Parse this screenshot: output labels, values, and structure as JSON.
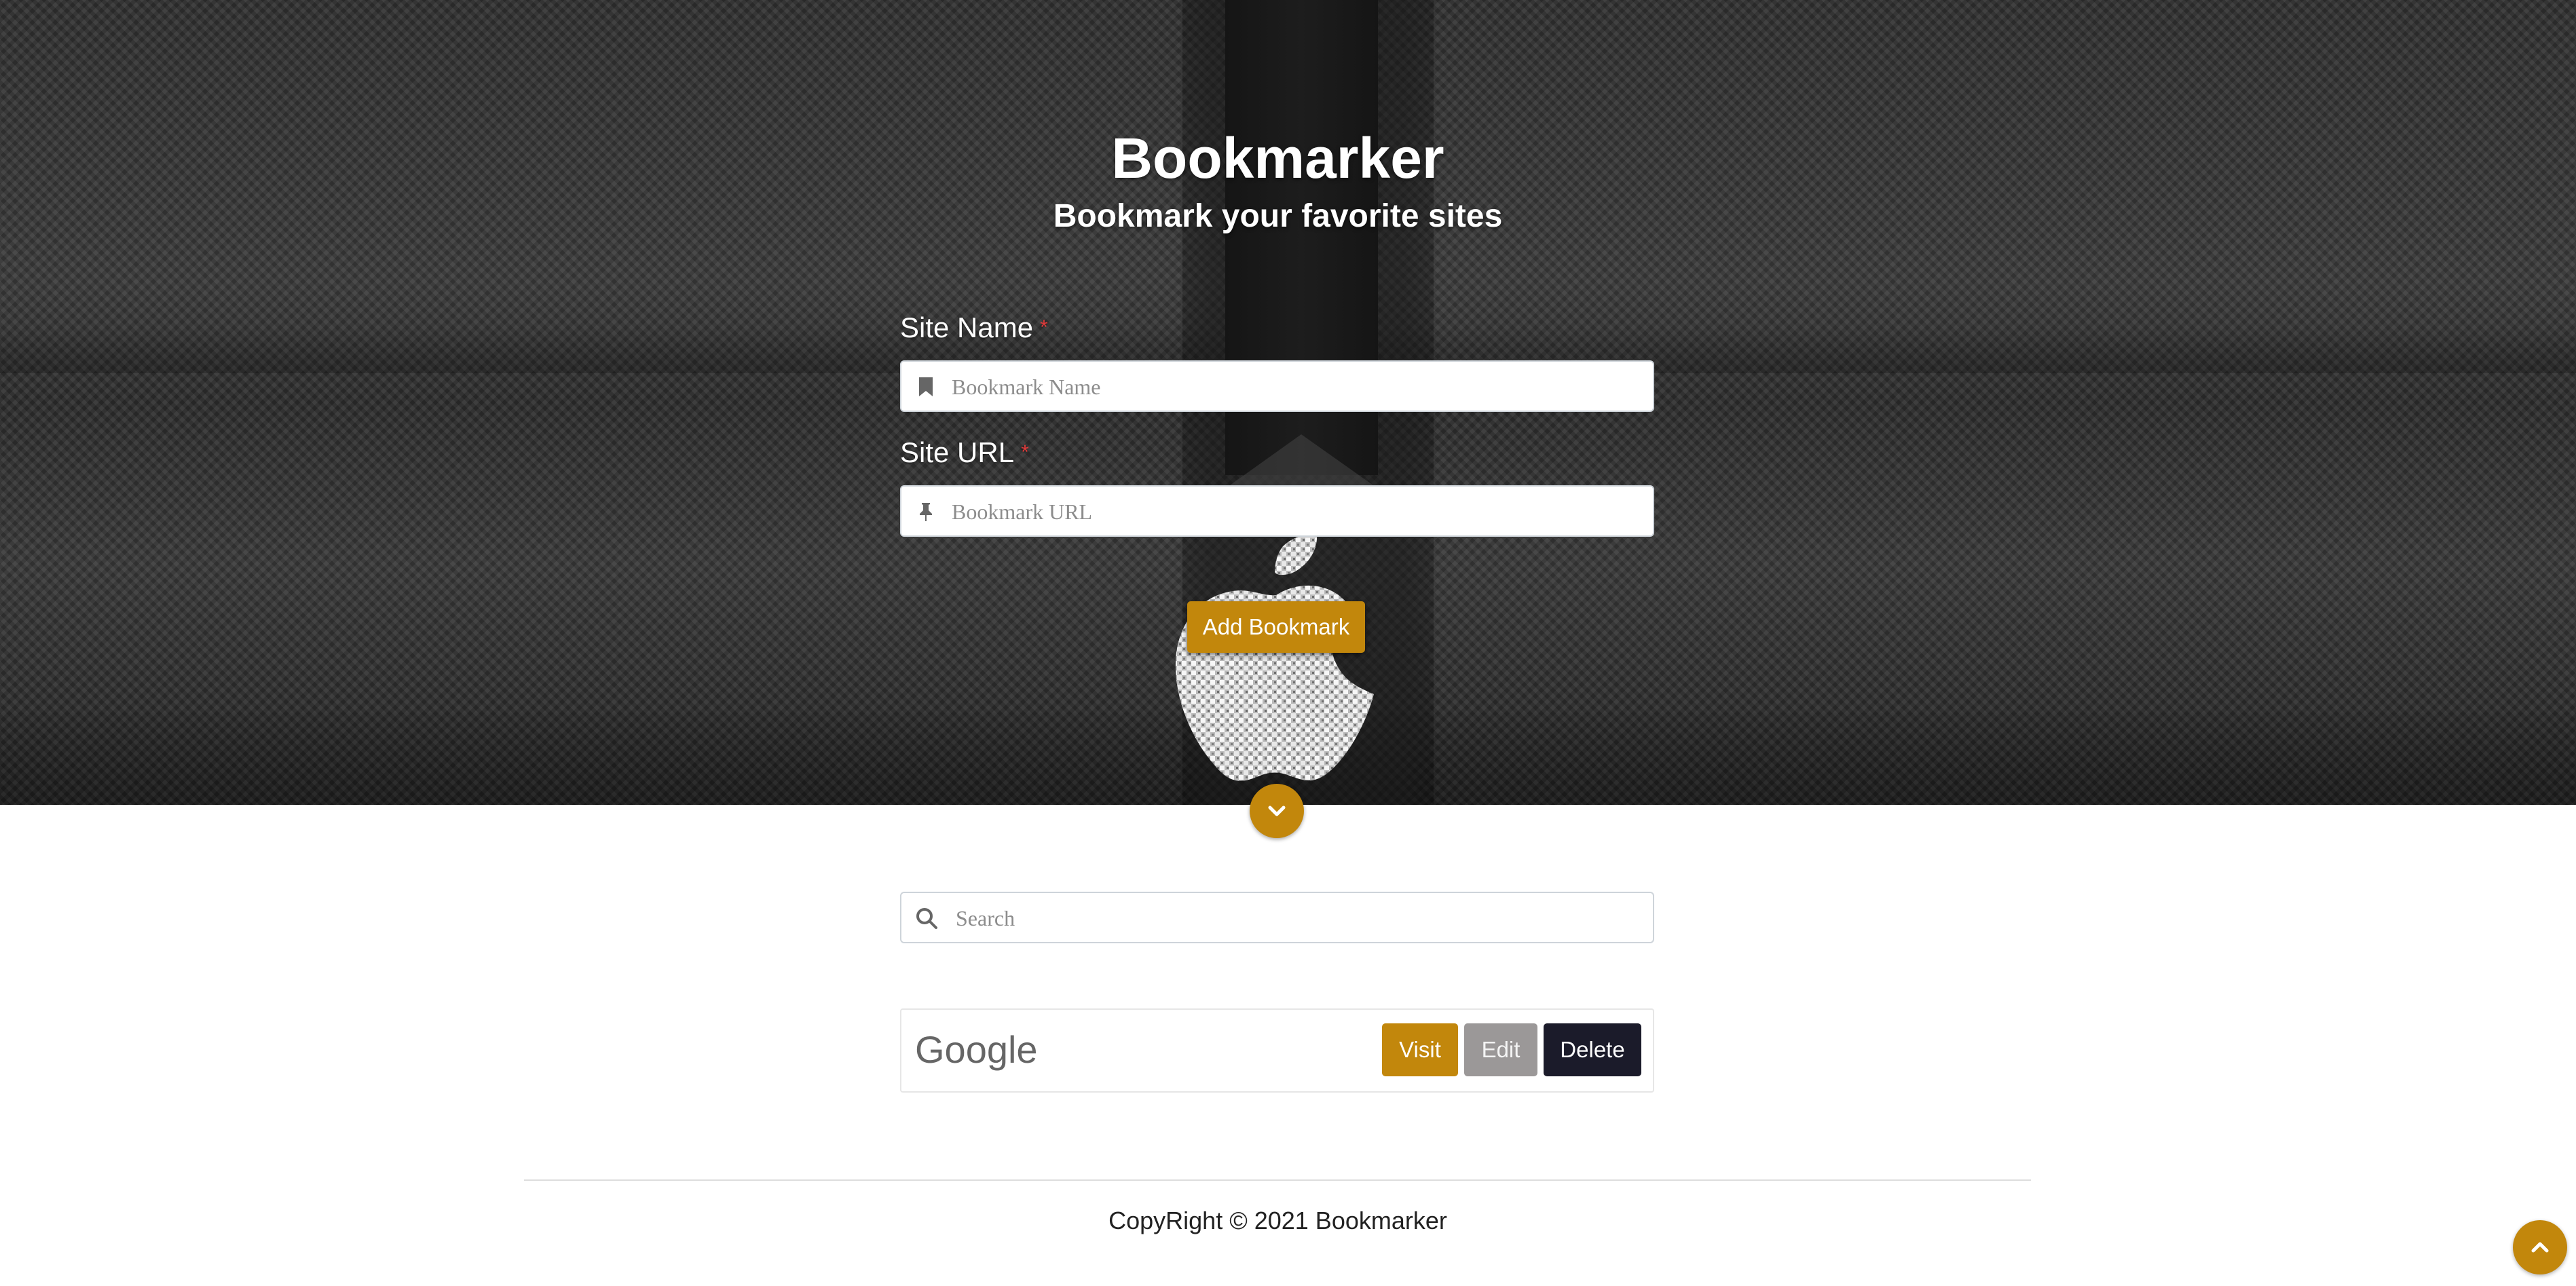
{
  "hero": {
    "title": "Bookmarker",
    "subtitle": "Bookmark your favorite sites"
  },
  "form": {
    "site_name_label": "Site Name",
    "site_name_required": "*",
    "site_name_placeholder": "Bookmark Name",
    "site_name_value": "",
    "site_name_icon": "bookmark-icon",
    "site_url_label": "Site URL",
    "site_url_required": "*",
    "site_url_placeholder": "Bookmark URL",
    "site_url_value": "",
    "site_url_icon": "thumbtack-icon",
    "add_button_label": "Add Bookmark"
  },
  "search": {
    "placeholder": "Search",
    "value": "",
    "icon": "search-icon"
  },
  "bookmarks": [
    {
      "name": "Google",
      "visit_label": "Visit",
      "edit_label": "Edit",
      "delete_label": "Delete"
    }
  ],
  "footer": {
    "text": "CopyRight © 2021 Bookmarker"
  },
  "colors": {
    "accent": "#c2870c",
    "edit_button": "#9b9898",
    "delete_button": "#1b1b2a",
    "required_star": "#e03b3b"
  }
}
